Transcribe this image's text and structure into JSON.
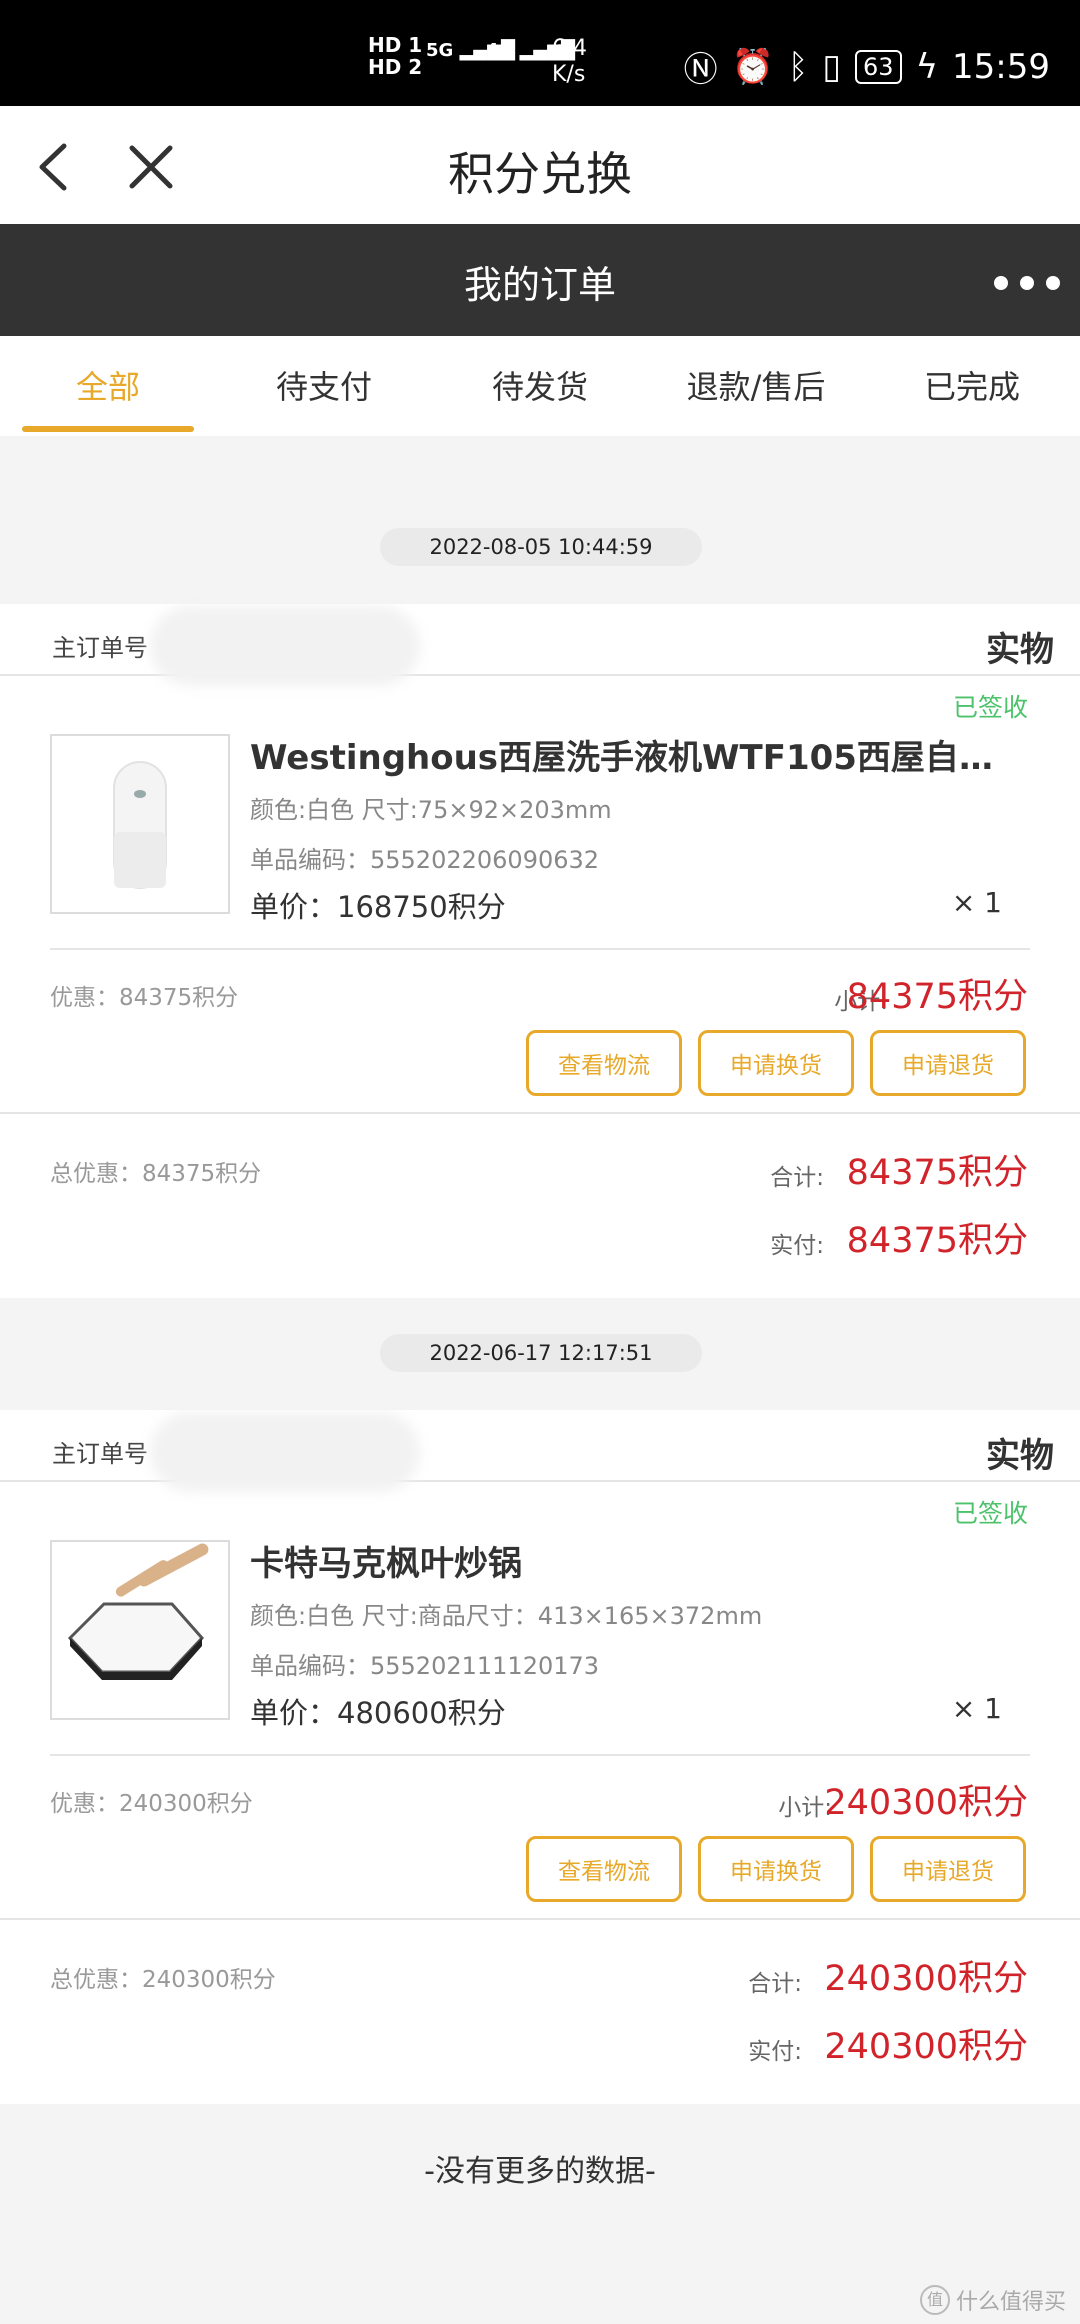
{
  "status_bar": {
    "sim": "HD 1\nHD 2",
    "net1": "5G",
    "net2": "4G",
    "speed": "6.4\nK/s",
    "battery": "63",
    "time": "15:59"
  },
  "title_bar": {
    "title": "积分兑换"
  },
  "header": {
    "title": "我的订单"
  },
  "tabs": [
    {
      "label": "全部"
    },
    {
      "label": "待支付"
    },
    {
      "label": "待发货"
    },
    {
      "label": "退款/售后"
    },
    {
      "label": "已完成"
    }
  ],
  "orders": [
    {
      "date": "2022-08-05 10:44:59",
      "order_no_label": "主订单号",
      "kind": "实物",
      "status": "已签收",
      "product_name": "Westinghous西屋洗手液机WTF105西屋自动...",
      "spec": "颜色:白色   尺寸:75×92×203mm",
      "sku": "单品编码：555202206090632",
      "price": "单价：168750积分",
      "qty": "× 1",
      "discount": "优惠：84375积分",
      "subtotal_label": "小计:",
      "subtotal": "84375积分",
      "buttons": [
        "查看物流",
        "申请换货",
        "申请退货"
      ],
      "total_discount": "总优惠：84375积分",
      "total_label": "合计:",
      "total": "84375积分",
      "paid_label": "实付:",
      "paid": "84375积分"
    },
    {
      "date": "2022-06-17 12:17:51",
      "order_no_label": "主订单号",
      "kind": "实物",
      "status": "已签收",
      "product_name": "卡特马克枫叶炒锅",
      "spec": "颜色:白色   尺寸:商品尺寸：413×165×372mm",
      "sku": "单品编码：555202111120173",
      "price": "单价：480600积分",
      "qty": "× 1",
      "discount": "优惠：240300积分",
      "subtotal_label": "小计:",
      "subtotal": "240300积分",
      "buttons": [
        "查看物流",
        "申请换货",
        "申请退货"
      ],
      "total_discount": "总优惠：240300积分",
      "total_label": "合计:",
      "total": "240300积分",
      "paid_label": "实付:",
      "paid": "240300积分"
    }
  ],
  "footer": {
    "no_more": "-没有更多的数据-"
  },
  "watermark": {
    "icon": "值",
    "text": "什么值得买"
  },
  "colors": {
    "accent": "#e8a92a",
    "price": "#d1232a",
    "status": "#4cc36b",
    "header": "#333333"
  }
}
